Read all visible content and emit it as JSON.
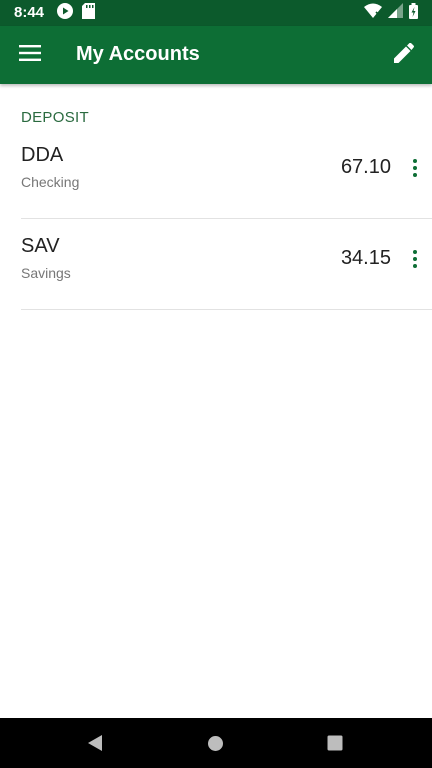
{
  "status_bar": {
    "time": "8:44",
    "left_icons": [
      "play-store-icon",
      "sd-card-icon"
    ],
    "right_icons": [
      "wifi-icon",
      "signal-icon",
      "battery-charging-icon"
    ]
  },
  "app_bar": {
    "title": "My Accounts",
    "menu_icon": "menu-icon",
    "action_icon": "edit-icon",
    "color": "#0d6e35"
  },
  "section": {
    "title": "DEPOSIT"
  },
  "accounts": [
    {
      "code": "DDA",
      "type": "Checking",
      "balance": "67.10"
    },
    {
      "code": "SAV",
      "type": "Savings",
      "balance": "34.15"
    }
  ],
  "nav_bar": {
    "icons": [
      "back-icon",
      "home-icon",
      "recents-icon"
    ]
  },
  "colors": {
    "status_bar": "#0c5a2c",
    "primary": "#0d6e35",
    "section_header": "#2a6a3f"
  }
}
